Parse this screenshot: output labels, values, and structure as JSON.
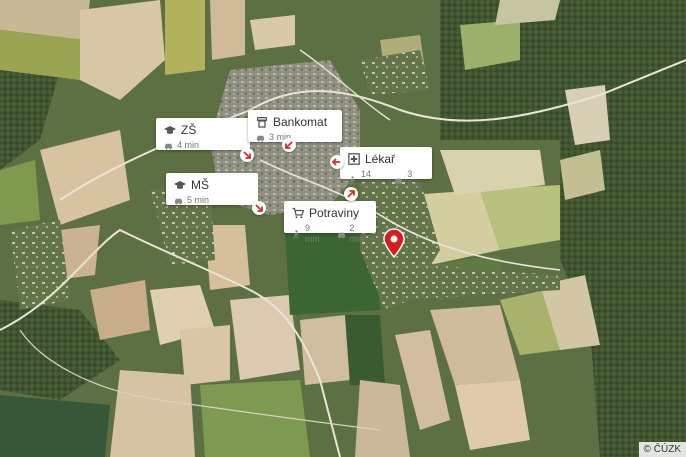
{
  "map": {
    "type": "satellite-aerial"
  },
  "pois": [
    {
      "id": "zs",
      "label": "ZŠ",
      "icon": "school-icon",
      "times": [
        {
          "mode": "car",
          "icon": "car-icon",
          "value": "4 min"
        }
      ]
    },
    {
      "id": "bankomat",
      "label": "Bankomat",
      "icon": "atm-icon",
      "times": [
        {
          "mode": "car",
          "icon": "car-icon",
          "value": "3 min"
        }
      ]
    },
    {
      "id": "lekar",
      "label": "Lékař",
      "icon": "doctor-icon",
      "times": [
        {
          "mode": "walk",
          "icon": "walk-icon",
          "value": "14 min"
        },
        {
          "mode": "car",
          "icon": "car-icon",
          "value": "3 min"
        }
      ]
    },
    {
      "id": "ms",
      "label": "MŠ",
      "icon": "school-icon",
      "times": [
        {
          "mode": "car",
          "icon": "car-icon",
          "value": "5 min"
        }
      ]
    },
    {
      "id": "potraviny",
      "label": "Potraviny",
      "icon": "cart-icon",
      "times": [
        {
          "mode": "walk",
          "icon": "walk-icon",
          "value": "9 min"
        },
        {
          "mode": "car",
          "icon": "car-icon",
          "value": "2 min"
        }
      ]
    }
  ],
  "pin": {
    "icon": "location-pin-icon",
    "color": "#d81b1b"
  },
  "arrow_color": "#d32f2f",
  "attribution": "© ČÚZK"
}
